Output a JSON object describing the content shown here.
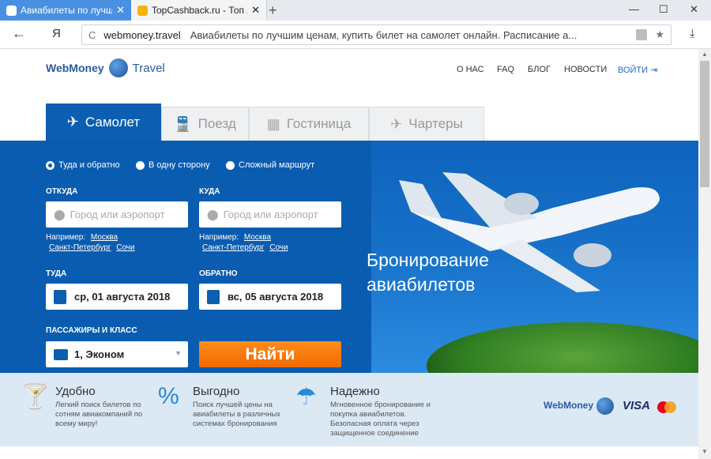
{
  "browser": {
    "tabs": [
      {
        "title": "Авиабилеты по лучшим",
        "close": "✕"
      },
      {
        "title": "TopCashback.ru - Топ лучши",
        "close": "✕"
      }
    ],
    "new_tab": "+",
    "window_controls": {
      "minimize": "—",
      "maximize": "☐",
      "close": "✕"
    },
    "back": "←",
    "ya": "Я",
    "reload": "C",
    "domain": "webmoney.travel",
    "page_title": "Авиабилеты по лучшим ценам, купить билет на самолет онлайн. Расписание а...",
    "star": "★",
    "download": "⤓"
  },
  "site": {
    "logo": {
      "brand": "WebMoney",
      "travel": "Travel"
    },
    "nav": {
      "about": "О НАС",
      "faq": "FAQ",
      "blog": "БЛОГ",
      "news": "НОВОСТИ",
      "login": "ВОЙТИ"
    }
  },
  "tabs": [
    {
      "label": "Самолет",
      "icon": "✈"
    },
    {
      "label": "Поезд",
      "icon": "🚆"
    },
    {
      "label": "Гостиница",
      "icon": "▦"
    },
    {
      "label": "Чартеры",
      "icon": "✈"
    }
  ],
  "search": {
    "trip_types": [
      "Туда и обратно",
      "В одну сторону",
      "Сложный маршрут"
    ],
    "from_label": "ОТКУДА",
    "to_label": "КУДА",
    "from_placeholder": "Город или аэропорт",
    "to_placeholder": "Город или аэропорт",
    "example_label": "Например:",
    "from_examples": [
      "Москва",
      "Санкт-Петербург",
      "Сочи"
    ],
    "to_examples": [
      "Москва",
      "Санкт-Петербург",
      "Сочи"
    ],
    "depart_label": "ТУДА",
    "return_label": "ОБРАТНО",
    "depart_date": "ср, 01 августа 2018",
    "return_date": "вс, 05 августа 2018",
    "pax_label": "ПАССАЖИРЫ И КЛАСС",
    "pax_value": "1, Эконом",
    "find": "Найти"
  },
  "hero": {
    "line1": "Бронирование",
    "line2": "авиабилетов"
  },
  "features": [
    {
      "title": "Удобно",
      "desc": "Легкий поиск билетов по сотням авиакомпаний по всему миру!"
    },
    {
      "title": "Выгодно",
      "desc": "Поиск лучшей цены на авиабилеты в различных системах бронирования"
    },
    {
      "title": "Надежно",
      "desc": "Мгновенное бронирование и покупка авиабилетов. Безопасная оплата через защищенное соединение"
    }
  ],
  "payments": {
    "webmoney": "WebMoney",
    "visa": "VISA"
  }
}
